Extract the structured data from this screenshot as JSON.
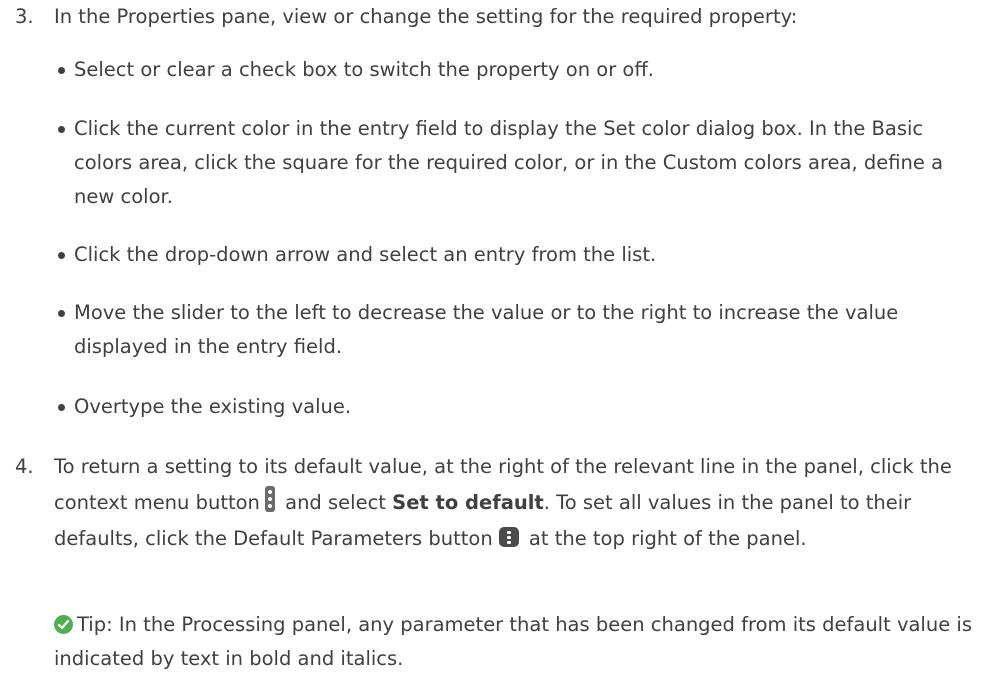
{
  "step3": {
    "number": "3.",
    "intro": "In the Properties pane, view or change the setting for the required property:",
    "bullets": {
      "checkbox": "Select or clear a check box to switch the property on or off.",
      "color_a": "Click the current color in the entry field to display the ",
      "color_set_color": "Set color",
      "color_b": " dialog box. In the ",
      "color_basic_colors": "Basic colors",
      "color_c": " area, click the square for the required color, or in the ",
      "color_custom_colors": "Custom colors",
      "color_d": " area, define a new color.",
      "dropdown": "Click the drop-down arrow and select an entry from the list.",
      "slider": "Move the slider to the left to decrease the value or to the right to increase the value displayed in the entry field.",
      "overtype": "Overtype the existing value."
    }
  },
  "step4": {
    "number": "4.",
    "text_a": "To return a setting to its default value, at the right of the relevant line in the panel, click the context menu button",
    "text_b": " and select ",
    "set_to_default": "Set to default",
    "text_c": ". To set all values in the panel to their defaults, click the Default Parameters button",
    "text_d": " at the top right of the panel."
  },
  "tip": {
    "label": "Tip",
    "text": ": In the Processing panel, any parameter that has been changed from its default value is indicated by text in bold and italics."
  },
  "icons": {
    "context_menu": "context-menu-icon",
    "default_parameters": "default-parameters-icon",
    "tip": "checkmark-circle-icon"
  },
  "colors": {
    "text": "#404040",
    "tip_green": "#4fae50"
  }
}
